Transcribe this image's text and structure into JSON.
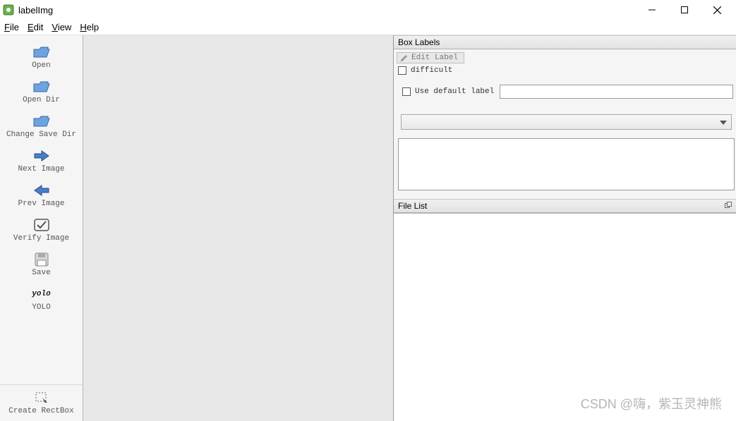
{
  "window": {
    "title": "labelImg"
  },
  "menubar": {
    "file": "File",
    "edit": "Edit",
    "view": "View",
    "help": "Help"
  },
  "toolbar": {
    "open": "Open",
    "open_dir": "Open Dir",
    "change_save_dir": "Change Save Dir",
    "next_image": "Next Image",
    "prev_image": "Prev Image",
    "verify_image": "Verify Image",
    "save": "Save",
    "format_icon": "yolo",
    "format": "YOLO",
    "create_rectbox": "Create RectBox"
  },
  "panels": {
    "box_labels": {
      "title": "Box Labels",
      "edit_label": "Edit Label",
      "difficult": "difficult",
      "use_default_label": "Use default label"
    },
    "file_list": {
      "title": "File List"
    }
  },
  "watermark": "CSDN @嗨，紫玉灵神熊"
}
